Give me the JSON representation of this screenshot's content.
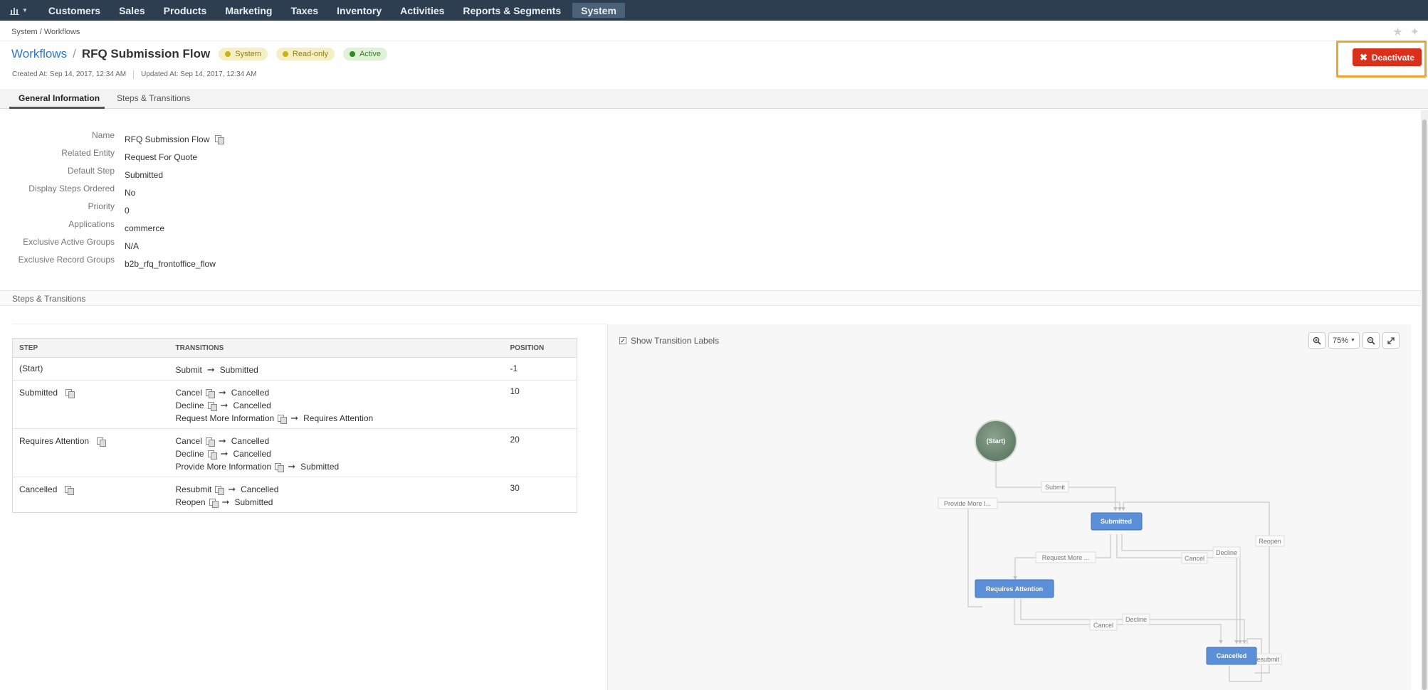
{
  "nav": {
    "items": [
      "Customers",
      "Sales",
      "Products",
      "Marketing",
      "Taxes",
      "Inventory",
      "Activities",
      "Reports & Segments",
      "System"
    ],
    "active": "System"
  },
  "breadcrumb": "System / Workflows",
  "title": {
    "link": "Workflows",
    "separator": "/",
    "name": "RFQ Submission Flow",
    "badges": [
      {
        "label": "System",
        "color": "yellow"
      },
      {
        "label": "Read-only",
        "color": "yellow"
      },
      {
        "label": "Active",
        "color": "green"
      }
    ]
  },
  "meta": {
    "created": "Created At: Sep 14, 2017, 12:34 AM",
    "updated": "Updated At: Sep 14, 2017, 12:34 AM"
  },
  "actions": {
    "deactivate_label": "Deactivate"
  },
  "tabs": [
    "General Information",
    "Steps & Transitions"
  ],
  "general_info": [
    {
      "label": "Name",
      "value": "RFQ Submission Flow",
      "translatable": true
    },
    {
      "label": "Related Entity",
      "value": "Request For Quote"
    },
    {
      "label": "Default Step",
      "value": "Submitted"
    },
    {
      "label": "Display Steps Ordered",
      "value": "No"
    },
    {
      "label": "Priority",
      "value": "0"
    },
    {
      "label": "Applications",
      "value": "commerce"
    },
    {
      "label": "Exclusive Active Groups",
      "value": "N/A"
    },
    {
      "label": "Exclusive Record Groups",
      "value": "b2b_rfq_frontoffice_flow"
    }
  ],
  "steps_section_title": "Steps & Transitions",
  "steps_table": {
    "headers": [
      "STEP",
      "TRANSITIONS",
      "POSITION"
    ],
    "rows": [
      {
        "step": "(Start)",
        "translatable": false,
        "position": "-1",
        "transitions": [
          {
            "name": "Submit",
            "target": "Submitted",
            "translatable": false
          }
        ]
      },
      {
        "step": "Submitted",
        "translatable": true,
        "position": "10",
        "transitions": [
          {
            "name": "Cancel",
            "target": "Cancelled",
            "translatable": true
          },
          {
            "name": "Decline",
            "target": "Cancelled",
            "translatable": true
          },
          {
            "name": "Request More Information",
            "target": "Requires Attention",
            "translatable": true
          }
        ]
      },
      {
        "step": "Requires Attention",
        "translatable": true,
        "position": "20",
        "transitions": [
          {
            "name": "Cancel",
            "target": "Cancelled",
            "translatable": true
          },
          {
            "name": "Decline",
            "target": "Cancelled",
            "translatable": true
          },
          {
            "name": "Provide More Information",
            "target": "Submitted",
            "translatable": true
          }
        ]
      },
      {
        "step": "Cancelled",
        "translatable": true,
        "position": "30",
        "transitions": [
          {
            "name": "Resubmit",
            "target": "Cancelled",
            "translatable": true
          },
          {
            "name": "Reopen",
            "target": "Submitted",
            "translatable": true
          }
        ]
      }
    ]
  },
  "diagram": {
    "show_labels": "Show Transition Labels",
    "zoom": "75%",
    "nodes": {
      "start": "(Start)",
      "submitted": "Submitted",
      "requires_attention": "Requires Attention",
      "cancelled": "Cancelled"
    },
    "edge_labels": {
      "submit": "Submit",
      "provide_more": "Provide More I...",
      "reopen": "Reopen",
      "request_more": "Request More ...",
      "cancel_1": "Cancel",
      "decline_1": "Decline",
      "cancel_2": "Cancel",
      "decline_2": "Decline",
      "resubmit": "Resubmit"
    }
  },
  "colors": {
    "nav_bg": "#2c3e50",
    "link": "#2b7ac6",
    "deactivate": "#d9301c",
    "highlight": "#f0a531",
    "node_blue": "#5b8fd8",
    "node_start": "#6f8a74"
  }
}
